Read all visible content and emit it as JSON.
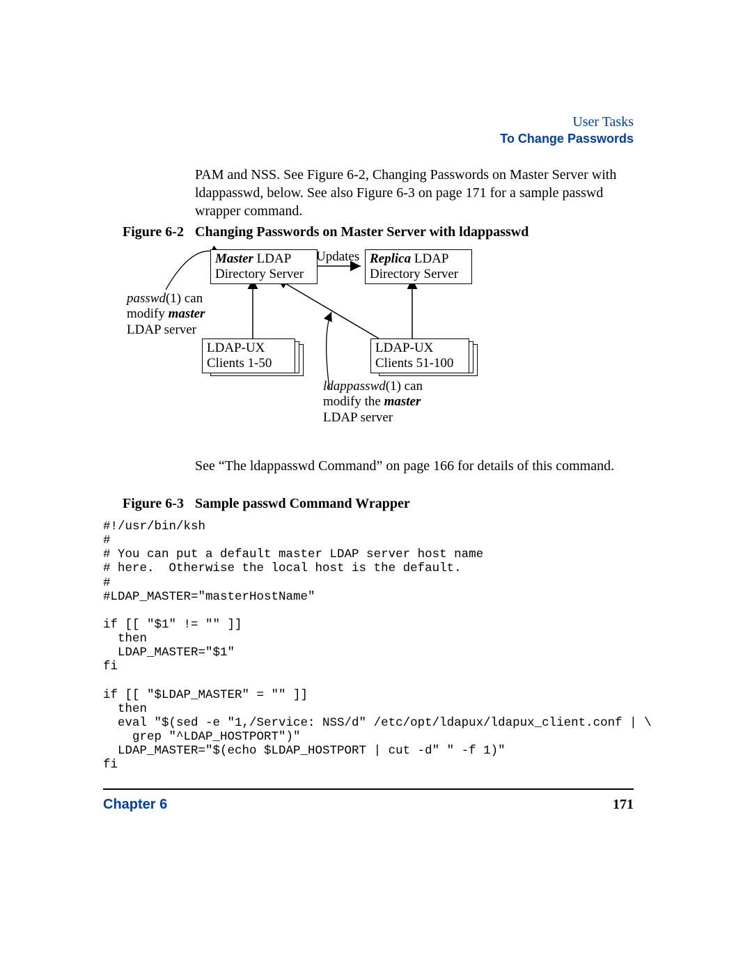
{
  "header": {
    "section": "User Tasks",
    "subsection": "To Change Passwords"
  },
  "intro": "PAM and NSS. See Figure 6-2, Changing Passwords on Master Server with ldappasswd, below. See also Figure 6-3 on page 171 for a sample passwd wrapper command.",
  "figure62": {
    "label": "Figure 6-2",
    "title": "Changing Passwords on Master Server with ldappasswd"
  },
  "diagram": {
    "master_line1_em": "Master",
    "master_line1_rest": " LDAP",
    "master_line2": "Directory Server",
    "updates": "Updates",
    "replica_line1_em": "Replica",
    "replica_line1_rest": " LDAP",
    "replica_line2": "Directory Server",
    "clients_left_l1": "LDAP-UX",
    "clients_left_l2": "Clients 1-50",
    "clients_right_l1": "LDAP-UX",
    "clients_right_l2": "Clients 51-100",
    "annot_left_l1_em": "passwd",
    "annot_left_l1_rest": "(1) can",
    "annot_left_l2_a": "modify ",
    "annot_left_l2_em": "master",
    "annot_left_l3": "LDAP server",
    "annot_bot_l1_em": "ldappasswd",
    "annot_bot_l1_rest": "(1) can",
    "annot_bot_l2_a": "modify the ",
    "annot_bot_l2_em": "master",
    "annot_bot_l3": "LDAP server"
  },
  "see_text": "See “The ldappasswd Command” on page 166 for details of this command.",
  "figure63": {
    "label": "Figure 6-3",
    "title": "Sample passwd Command Wrapper"
  },
  "code": "#!/usr/bin/ksh\n#\n# You can put a default master LDAP server host name\n# here.  Otherwise the local host is the default.\n#\n#LDAP_MASTER=\"masterHostName\"\n\nif [[ \"$1\" != \"\" ]]\n  then\n  LDAP_MASTER=\"$1\"\nfi\n\nif [[ \"$LDAP_MASTER\" = \"\" ]]\n  then\n  eval \"$(sed -e \"1,/Service: NSS/d\" /etc/opt/ldapux/ldapux_client.conf | \\\n    grep \"^LDAP_HOSTPORT\")\"\n  LDAP_MASTER=\"$(echo $LDAP_HOSTPORT | cut -d\" \" -f 1)\"\nfi",
  "footer": {
    "left": "Chapter 6",
    "right": "171"
  }
}
